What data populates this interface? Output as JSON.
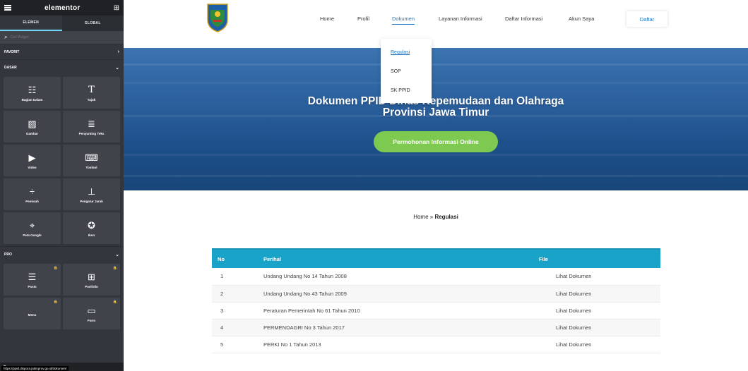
{
  "sidebar": {
    "logo": "elementor",
    "tabs": [
      {
        "label": "ELEMEN"
      },
      {
        "label": "GLOBAL"
      }
    ],
    "search_placeholder": "Cari Widget",
    "categories": {
      "favorit": "FAVORIT",
      "dasar": "DASAR",
      "pro": "PRO"
    },
    "basic_widgets": [
      {
        "label": "Bagian Dalam",
        "icon": "inner-section-icon"
      },
      {
        "label": "Tajuk",
        "icon": "heading-icon"
      },
      {
        "label": "Gambar",
        "icon": "image-icon"
      },
      {
        "label": "Penyunting Teks",
        "icon": "text-editor-icon"
      },
      {
        "label": "Video",
        "icon": "video-icon"
      },
      {
        "label": "Tombol",
        "icon": "button-icon"
      },
      {
        "label": "Pemisah",
        "icon": "divider-icon"
      },
      {
        "label": "Pengatur Jarak",
        "icon": "spacer-icon"
      },
      {
        "label": "Peta Google",
        "icon": "map-icon"
      },
      {
        "label": "Ikon",
        "icon": "star-icon"
      }
    ],
    "pro_widgets": [
      {
        "label": "Posts",
        "icon": "posts-icon"
      },
      {
        "label": "Portfolio",
        "icon": "portfolio-icon"
      },
      {
        "label": "Menu",
        "icon": "menu-icon"
      },
      {
        "label": "Form",
        "icon": "form-icon"
      }
    ],
    "status_url": "https://ppid.dispora.jatimprov.go.id/dokumen/"
  },
  "nav": {
    "items": [
      {
        "label": "Home"
      },
      {
        "label": "Profil"
      },
      {
        "label": "Dokumen"
      },
      {
        "label": "Layanan Informasi"
      },
      {
        "label": "Daftar Informasi"
      },
      {
        "label": "Akun Saya"
      }
    ],
    "cta": "Daftar",
    "dropdown": [
      {
        "label": "Regulasi"
      },
      {
        "label": "SOP"
      },
      {
        "label": "SK PPID"
      }
    ]
  },
  "hero": {
    "title_line1": "Dokumen PPID Dinas Kepemudaan dan Olahraga",
    "title_line2": "Provinsi Jawa Timur",
    "button": "Permohonan Informasi Online"
  },
  "breadcrumb": {
    "home": "Home",
    "separator": "»",
    "current": "Regulasi"
  },
  "table": {
    "headers": {
      "no": "No",
      "perihal": "Perihal",
      "file": "File"
    },
    "rows": [
      {
        "no": "1",
        "perihal": "Undang Undang No 14 Tahun 2008",
        "file": "Lihat Dokumen"
      },
      {
        "no": "2",
        "perihal": "Undang Undang No 43 Tahun 2009",
        "file": "Lihat Dokumen"
      },
      {
        "no": "3",
        "perihal": "Peraturan Pemerintah No 61 Tahun 2010",
        "file": "Lihat Dokumen"
      },
      {
        "no": "4",
        "perihal": "PERMENDAGRI No 3 Tahun 2017",
        "file": "Lihat Dokumen"
      },
      {
        "no": "5",
        "perihal": "PERKI No 1 Tahun 2013",
        "file": "Lihat Dokumen"
      }
    ]
  },
  "colors": {
    "sidebar_bg": "#33373d",
    "accent": "#1e73be",
    "table_header": "#1aa3c9",
    "hero_button": "#7ec94f"
  }
}
